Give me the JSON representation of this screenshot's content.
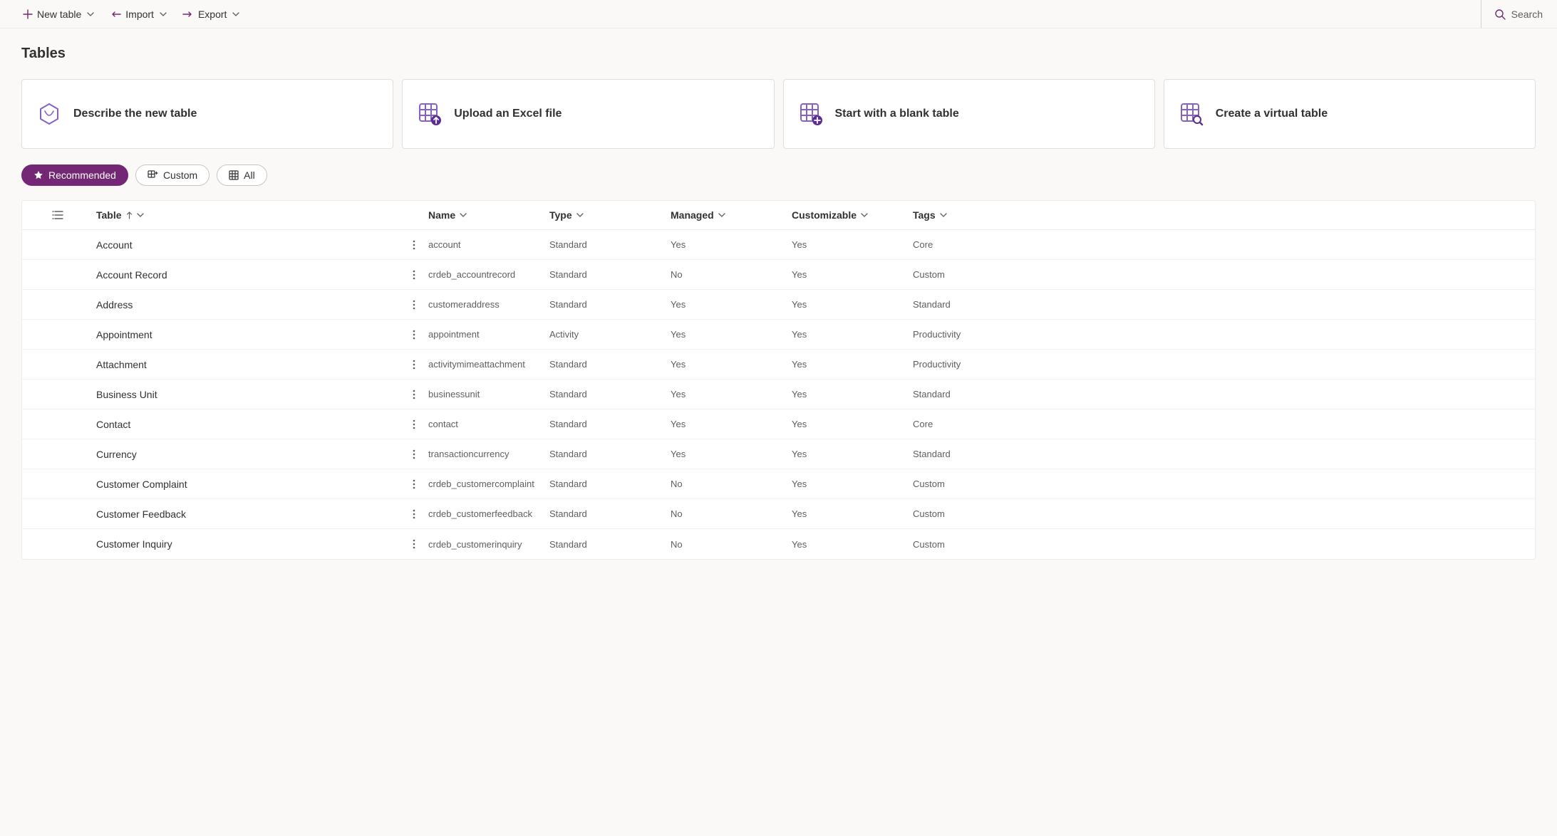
{
  "toolbar": {
    "new_table": "New table",
    "import": "Import",
    "export": "Export",
    "search": "Search"
  },
  "page": {
    "title": "Tables"
  },
  "cards": [
    {
      "label": "Describe the new table",
      "icon": "copilot"
    },
    {
      "label": "Upload an Excel file",
      "icon": "upload"
    },
    {
      "label": "Start with a blank table",
      "icon": "blank"
    },
    {
      "label": "Create a virtual table",
      "icon": "virtual"
    }
  ],
  "filters": {
    "recommended": "Recommended",
    "custom": "Custom",
    "all": "All"
  },
  "columns": {
    "table": "Table",
    "name": "Name",
    "type": "Type",
    "managed": "Managed",
    "customizable": "Customizable",
    "tags": "Tags"
  },
  "rows": [
    {
      "display": "Account",
      "name": "account",
      "type": "Standard",
      "managed": "Yes",
      "customizable": "Yes",
      "tags": "Core"
    },
    {
      "display": "Account Record",
      "name": "crdeb_accountrecord",
      "type": "Standard",
      "managed": "No",
      "customizable": "Yes",
      "tags": "Custom"
    },
    {
      "display": "Address",
      "name": "customeraddress",
      "type": "Standard",
      "managed": "Yes",
      "customizable": "Yes",
      "tags": "Standard"
    },
    {
      "display": "Appointment",
      "name": "appointment",
      "type": "Activity",
      "managed": "Yes",
      "customizable": "Yes",
      "tags": "Productivity"
    },
    {
      "display": "Attachment",
      "name": "activitymimeattachment",
      "type": "Standard",
      "managed": "Yes",
      "customizable": "Yes",
      "tags": "Productivity"
    },
    {
      "display": "Business Unit",
      "name": "businessunit",
      "type": "Standard",
      "managed": "Yes",
      "customizable": "Yes",
      "tags": "Standard"
    },
    {
      "display": "Contact",
      "name": "contact",
      "type": "Standard",
      "managed": "Yes",
      "customizable": "Yes",
      "tags": "Core"
    },
    {
      "display": "Currency",
      "name": "transactioncurrency",
      "type": "Standard",
      "managed": "Yes",
      "customizable": "Yes",
      "tags": "Standard"
    },
    {
      "display": "Customer Complaint",
      "name": "crdeb_customercomplaint",
      "type": "Standard",
      "managed": "No",
      "customizable": "Yes",
      "tags": "Custom"
    },
    {
      "display": "Customer Feedback",
      "name": "crdeb_customerfeedback",
      "type": "Standard",
      "managed": "No",
      "customizable": "Yes",
      "tags": "Custom"
    },
    {
      "display": "Customer Inquiry",
      "name": "crdeb_customerinquiry",
      "type": "Standard",
      "managed": "No",
      "customizable": "Yes",
      "tags": "Custom"
    }
  ]
}
